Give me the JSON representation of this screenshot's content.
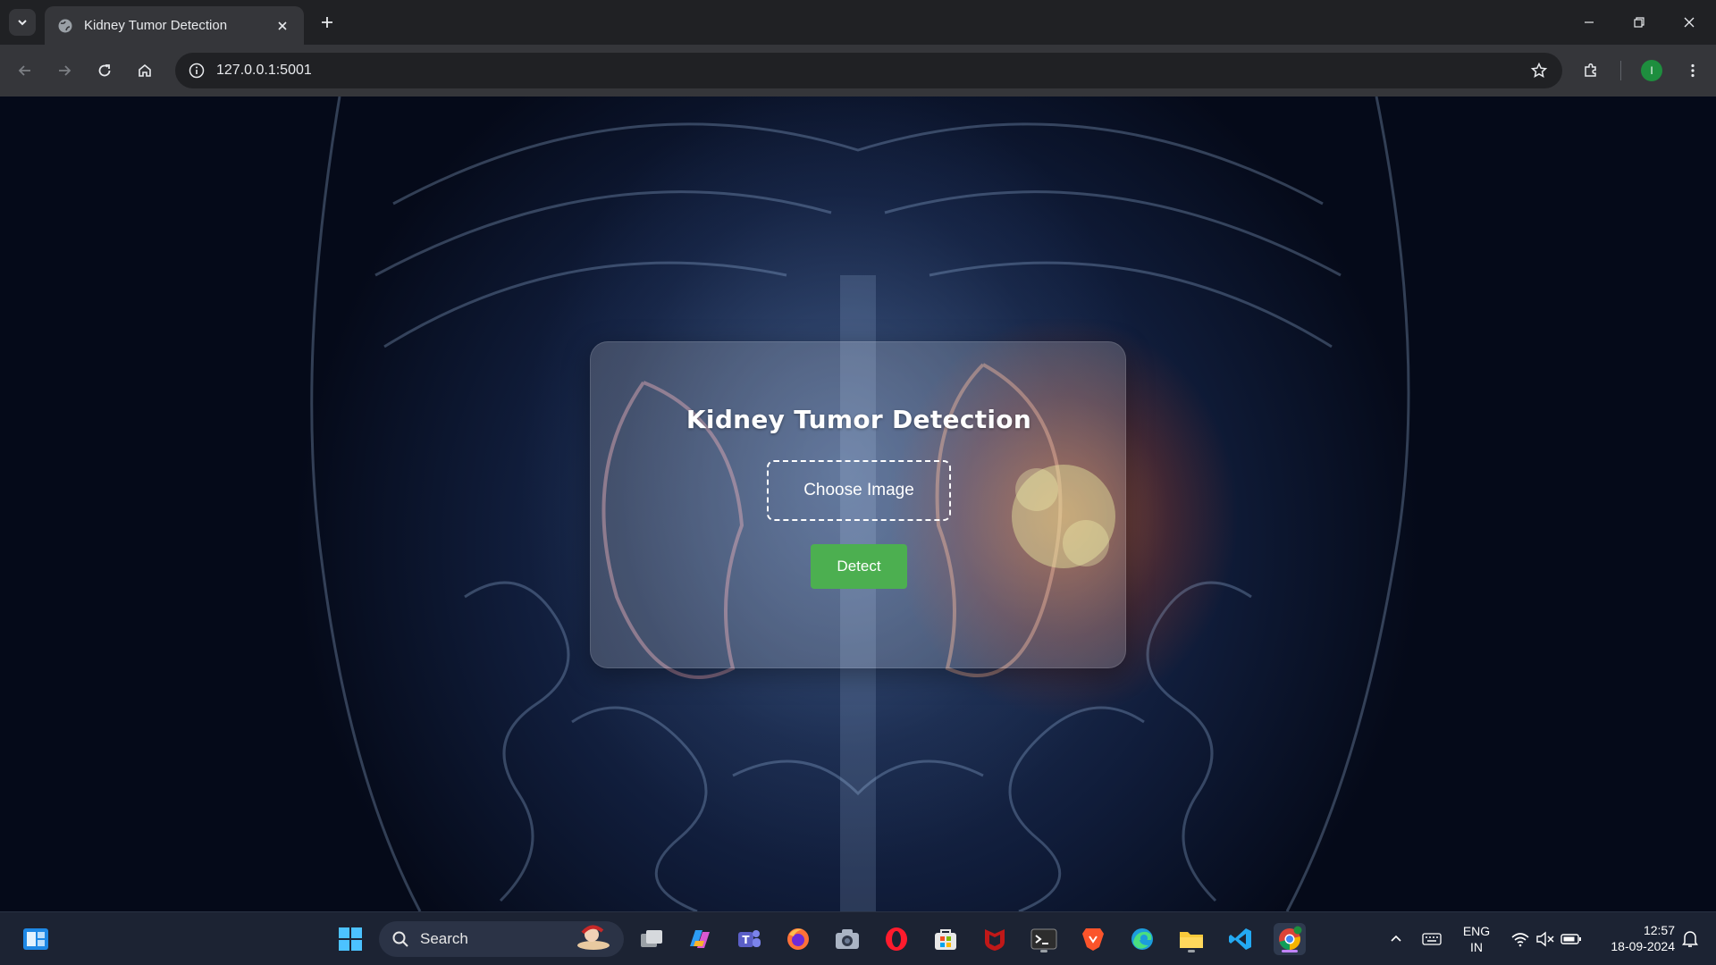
{
  "browser": {
    "tab_title": "Kidney Tumor Detection",
    "url": "127.0.0.1:5001",
    "profile_initial": "I"
  },
  "page": {
    "heading": "Kidney Tumor Detection",
    "choose_image_label": "Choose Image",
    "detect_label": "Detect",
    "colors": {
      "detect_button": "#4caf50",
      "card_bg": "rgba(255,255,255,0.18)"
    }
  },
  "taskbar": {
    "search_label": "Search",
    "apps": [
      "start-icon",
      "search-icon",
      "task-view-icon",
      "copilot-icon",
      "teams-icon",
      "firefox-icon",
      "camera-icon",
      "opera-icon",
      "microsoft-store-icon",
      "mcafee-icon",
      "terminal-icon",
      "brave-icon",
      "edge-icon",
      "file-explorer-icon",
      "vscode-icon",
      "chrome-icon"
    ],
    "language": "ENG",
    "region": "IN",
    "time": "12:57",
    "date": "18-09-2024"
  }
}
